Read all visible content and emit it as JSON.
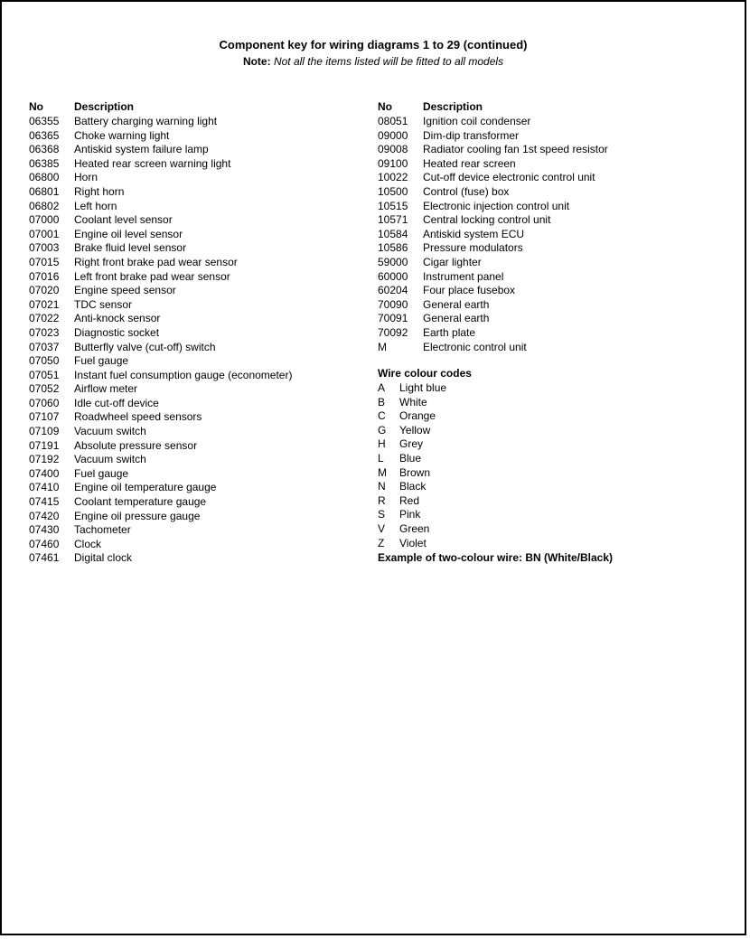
{
  "title": "Component key for wiring diagrams 1 to 29 (continued)",
  "note_label": "Note:",
  "note_text": "Not all the items listed will be fitted to all models",
  "headers": {
    "no": "No",
    "desc": "Description"
  },
  "left": [
    {
      "no": "06355",
      "desc": "Battery charging warning light"
    },
    {
      "no": "06365",
      "desc": "Choke warning light"
    },
    {
      "no": "06368",
      "desc": "Antiskid system failure lamp"
    },
    {
      "no": "06385",
      "desc": "Heated rear screen warning light"
    },
    {
      "no": "06800",
      "desc": "Horn"
    },
    {
      "no": "06801",
      "desc": "Right horn"
    },
    {
      "no": "06802",
      "desc": "Left horn"
    },
    {
      "no": "07000",
      "desc": "Coolant level sensor"
    },
    {
      "no": "07001",
      "desc": "Engine oil level sensor"
    },
    {
      "no": "07003",
      "desc": "Brake fluid level sensor"
    },
    {
      "no": "07015",
      "desc": "Right front brake pad wear sensor"
    },
    {
      "no": "07016",
      "desc": "Left front brake pad wear sensor"
    },
    {
      "no": "07020",
      "desc": "Engine speed sensor"
    },
    {
      "no": "07021",
      "desc": "TDC sensor"
    },
    {
      "no": "07022",
      "desc": "Anti-knock sensor"
    },
    {
      "no": "07023",
      "desc": "Diagnostic socket"
    },
    {
      "no": "07037",
      "desc": "Butterfly valve (cut-off) switch"
    },
    {
      "no": "07050",
      "desc": "Fuel gauge"
    },
    {
      "no": "07051",
      "desc": "Instant fuel consumption gauge (econometer)"
    },
    {
      "no": "07052",
      "desc": "Airflow meter"
    },
    {
      "no": "07060",
      "desc": "Idle cut-off device"
    },
    {
      "no": "07107",
      "desc": "Roadwheel speed sensors"
    },
    {
      "no": "07109",
      "desc": "Vacuum switch"
    },
    {
      "no": "07191",
      "desc": "Absolute pressure sensor"
    },
    {
      "no": "07192",
      "desc": "Vacuum switch"
    },
    {
      "no": "07400",
      "desc": "Fuel gauge"
    },
    {
      "no": "07410",
      "desc": "Engine oil temperature gauge"
    },
    {
      "no": "07415",
      "desc": "Coolant temperature gauge"
    },
    {
      "no": "07420",
      "desc": "Engine oil pressure gauge"
    },
    {
      "no": "07430",
      "desc": "Tachometer"
    },
    {
      "no": "07460",
      "desc": "Clock"
    },
    {
      "no": "07461",
      "desc": "Digital clock"
    }
  ],
  "right": [
    {
      "no": "08051",
      "desc": "Ignition coil condenser"
    },
    {
      "no": "09000",
      "desc": "Dim-dip transformer"
    },
    {
      "no": "09008",
      "desc": "Radiator cooling fan 1st speed resistor"
    },
    {
      "no": "09100",
      "desc": "Heated rear screen"
    },
    {
      "no": "10022",
      "desc": "Cut-off device electronic control unit"
    },
    {
      "no": "10500",
      "desc": "Control (fuse) box"
    },
    {
      "no": "10515",
      "desc": "Electronic injection control unit"
    },
    {
      "no": "10571",
      "desc": "Central locking control unit"
    },
    {
      "no": "10584",
      "desc": "Antiskid system ECU"
    },
    {
      "no": "10586",
      "desc": "Pressure modulators"
    },
    {
      "no": "59000",
      "desc": "Cigar lighter"
    },
    {
      "no": "60000",
      "desc": "Instrument panel"
    },
    {
      "no": "60204",
      "desc": "Four place fusebox"
    },
    {
      "no": "70090",
      "desc": "General earth"
    },
    {
      "no": "70091",
      "desc": "General earth"
    },
    {
      "no": "70092",
      "desc": "Earth plate"
    },
    {
      "no": "M",
      "desc": "Electronic control unit"
    }
  ],
  "wire_head": "Wire colour codes",
  "wire_codes": [
    {
      "code": "A",
      "name": "Light blue"
    },
    {
      "code": "B",
      "name": "White"
    },
    {
      "code": "C",
      "name": "Orange"
    },
    {
      "code": "G",
      "name": "Yellow"
    },
    {
      "code": "H",
      "name": "Grey"
    },
    {
      "code": "L",
      "name": "Blue"
    },
    {
      "code": "M",
      "name": "Brown"
    },
    {
      "code": "N",
      "name": "Black"
    },
    {
      "code": "R",
      "name": "Red"
    },
    {
      "code": "S",
      "name": "Pink"
    },
    {
      "code": "V",
      "name": "Green"
    },
    {
      "code": "Z",
      "name": "Violet"
    }
  ],
  "example": "Example of two-colour wire: BN (White/Black)"
}
